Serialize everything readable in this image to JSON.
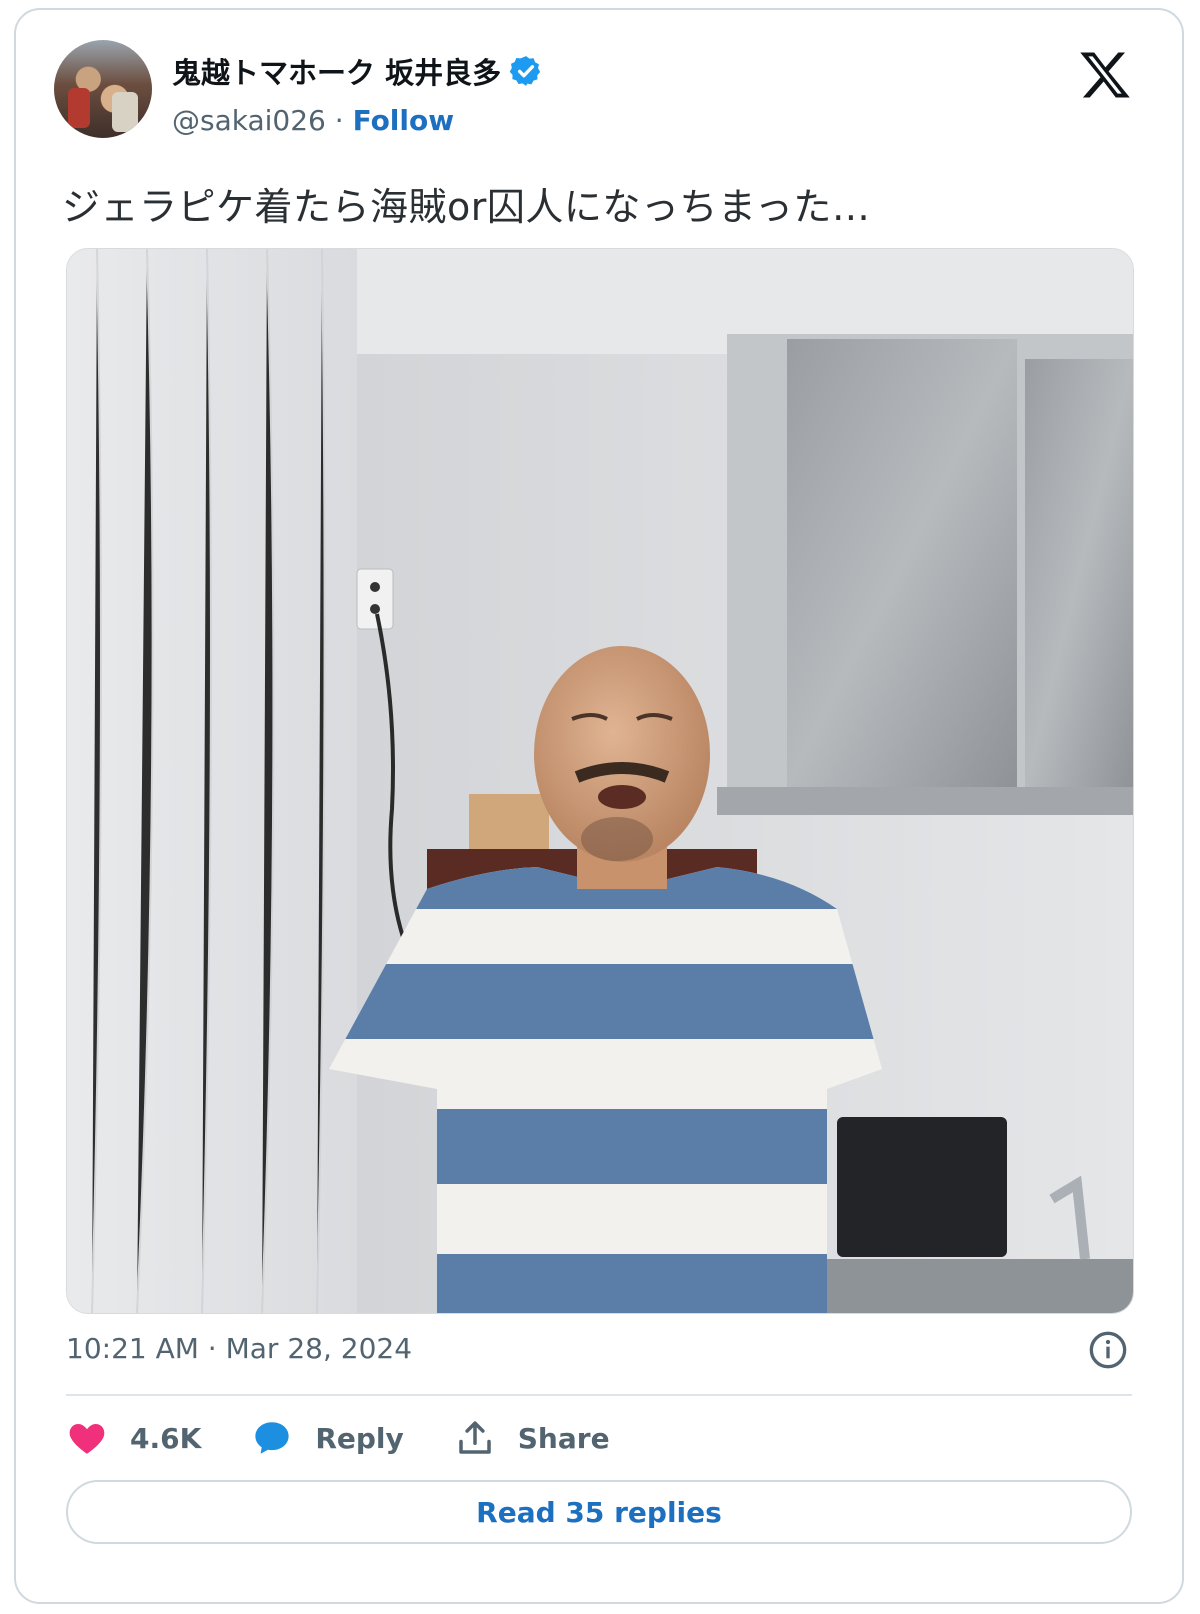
{
  "author": {
    "display_name": "鬼越トマホーク 坂井良多",
    "handle": "@sakai026",
    "separator": "·",
    "follow_label": "Follow",
    "verified_icon": "verified-badge-icon"
  },
  "brand": {
    "logo_icon": "x-logo-icon"
  },
  "tweet": {
    "text": "ジェラピケ着たら海賊or囚人になっちまった…",
    "image_icon": "photo-man-striped-shirt",
    "timestamp": "10:21 AM · Mar 28, 2024"
  },
  "actions": {
    "like_count": "4.6K",
    "reply_label": "Reply",
    "share_label": "Share",
    "read_replies_label": "Read 35 replies"
  },
  "colors": {
    "accent": "#1d6fc0",
    "like": "#f0307a",
    "verified": "#1d9bf0",
    "shirt_blue": "#5b7ea8"
  }
}
